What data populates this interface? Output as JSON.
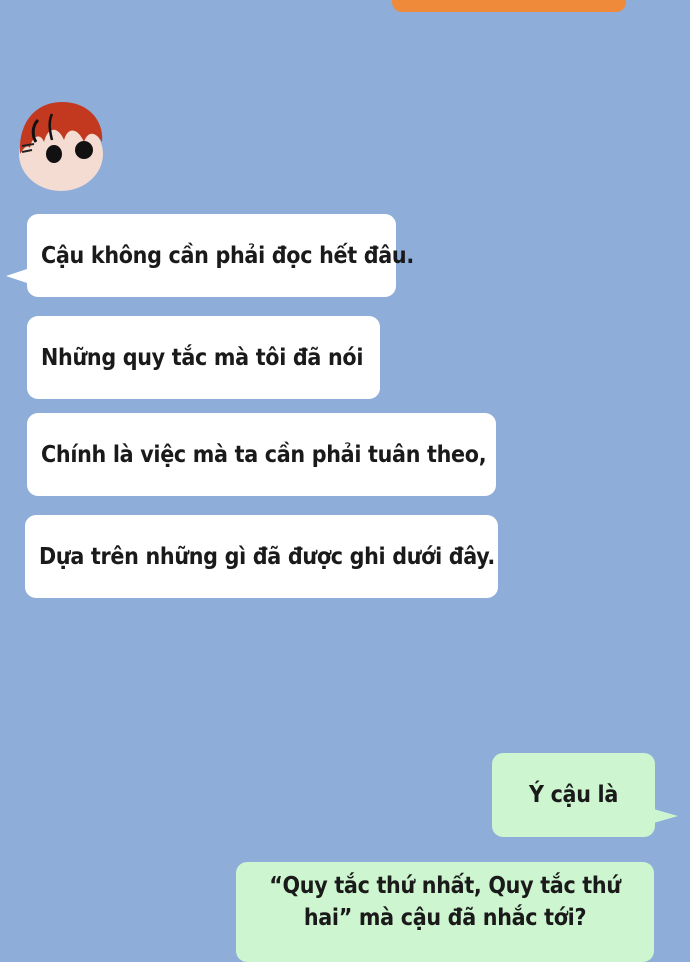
{
  "colors": {
    "background": "#8eadd9",
    "incoming_bubble": "#ffffff",
    "outgoing_bubble": "#cdf5cf",
    "top_bubble": "#ef8a3a",
    "avatar_hair": "#c2391f"
  },
  "icons": {
    "avatar": "red-haired-character-avatar"
  },
  "incoming_messages": [
    "Cậu không cần phải đọc hết đâu.",
    "Những quy tắc mà tôi đã nói",
    "Chính là việc mà ta cần phải tuân theo,",
    "Dựa trên những gì đã được ghi dưới đây."
  ],
  "outgoing_messages": [
    "Ý cậu là",
    "“Quy tắc thứ nhất, Quy tắc thứ hai” mà cậu đã nhắc tới?"
  ]
}
